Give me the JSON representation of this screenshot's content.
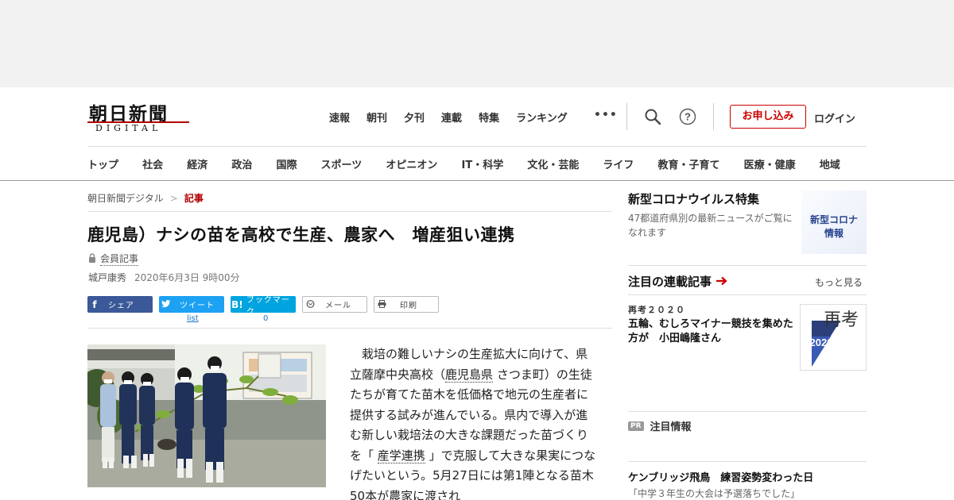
{
  "header": {
    "logo_main": "朝日新聞",
    "logo_sub": "DIGITAL",
    "top_nav": [
      "速報",
      "朝刊",
      "夕刊",
      "連載",
      "特集",
      "ランキング"
    ],
    "apply_label": "お申し込み",
    "login_label": "ログイン",
    "categories": [
      "トップ",
      "社会",
      "経済",
      "政治",
      "国際",
      "スポーツ",
      "オピニオン",
      "IT・科学",
      "文化・芸能",
      "ライフ",
      "教育・子育て",
      "医療・健康",
      "地域"
    ]
  },
  "breadcrumb": {
    "home": "朝日新聞デジタル",
    "current": "記事"
  },
  "article": {
    "headline": "鹿児島）ナシの苗を高校で生産、農家へ　増産狙い連携",
    "member_label": "会員記事",
    "author": "城戸康秀",
    "date": "2020年6月3日 9時00分",
    "body_1": "　栽培の難しいナシの生産拡大に向けて、県立薩摩中央高校（",
    "body_link_1": "鹿児島県",
    "body_2": "さつま町）の生徒たちが育てた苗木を低価格で地元の生産者に提供する試みが進んでいる。県内で導入が進む新しい栽培法の大きな課題だった苗づくりを「",
    "body_link_2": "産学連携",
    "body_3": "」で克服して大きな果実につなげたいという。5月27日には第1陣となる苗木50本が農家に渡され"
  },
  "share": {
    "facebook": "シェア",
    "twitter": "ツイート",
    "twitter_count": "list",
    "hatena": "ブックマーク",
    "hatena_count": "0",
    "mail": "メール",
    "print": "印刷"
  },
  "sidebar": {
    "covid_title": "新型コロナウイルス特集",
    "covid_desc": "47都道府県別の最新ニュースがご覧になれます",
    "covid_thumb_1": "新型コロナ",
    "covid_thumb_2": "情報",
    "series_title": "注目の連載記事",
    "series_more": "もっと見る",
    "saiko_kicker": "再考２０２０",
    "saiko_headline": "五輪、むしろマイナー競技を集めた方が　小田嶋隆さん",
    "saiko_thumb_big": "再考",
    "saiko_thumb_year": "2020",
    "pr_badge": "PR",
    "pr_label": "注目情報",
    "cam_headline": "ケンブリッジ飛鳥　練習姿勢変わった日",
    "cam_sub": "「中学３年生の大会は予選落ちでした」"
  },
  "colors": {
    "accent": "#b30000",
    "facebook": "#3b5998",
    "twitter": "#1da1f2",
    "hatena": "#00a4de"
  }
}
